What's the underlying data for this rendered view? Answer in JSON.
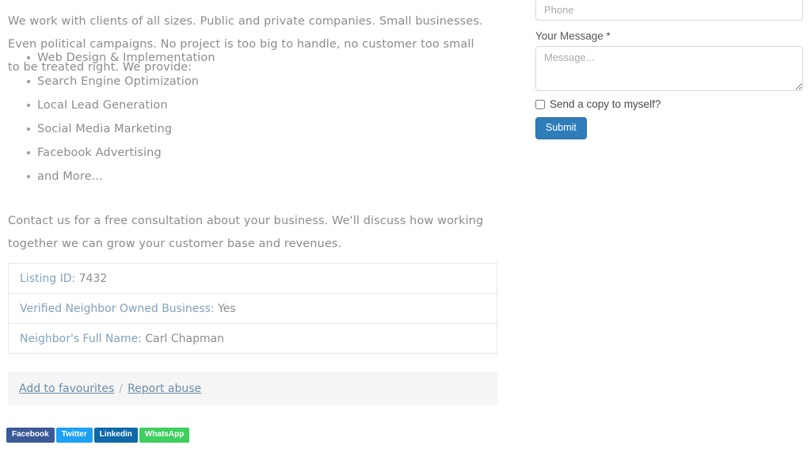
{
  "listing_body": {
    "intro_paragraph": "We work with clients of all sizes. Public and private companies. Small businesses. Even political campaigns. No project is too big to handle, no customer too small to be treated right. We provide:",
    "services": [
      "Web Design & Implementation",
      "Search Engine Optimization",
      "Local Lead Generation",
      "Social Media Marketing",
      "Facebook Advertising",
      "and More..."
    ],
    "outro_paragraph": "Contact us for a free consultation about your business. We'll discuss how working together we can grow your customer base and revenues."
  },
  "listing_details": {
    "rows": [
      {
        "label": "Listing ID:",
        "value": " 7432"
      },
      {
        "label": "Verified Neighbor Owned Business:",
        "value": " Yes"
      },
      {
        "label": "Neighbor's Full Name:",
        "value": " Carl Chapman"
      }
    ]
  },
  "actions": {
    "favourite_label": "Add to favourites",
    "separator": "/",
    "report_label": "Report abuse"
  },
  "social": {
    "buttons": [
      {
        "label": "Facebook",
        "color": "#3b5998"
      },
      {
        "label": "Twitter",
        "color": "#1da1f2"
      },
      {
        "label": "Linkedin",
        "color": "#0e69a8"
      },
      {
        "label": "WhatsApp",
        "color": "#3ecf5e"
      }
    ]
  },
  "contact_form": {
    "phone_placeholder": "Phone",
    "phone_value": "",
    "message_label": "Your Message *",
    "message_placeholder": "Message...",
    "message_value": "",
    "copy_checkbox_label": "Send a copy to myself?",
    "submit_label": "Submit",
    "accent_color": "#2e7cb8"
  }
}
